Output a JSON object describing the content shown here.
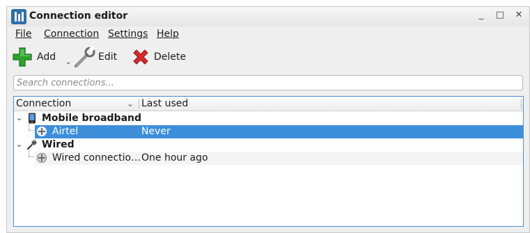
{
  "window": {
    "title": "Connection editor"
  },
  "window_controls": {
    "minimize": "_",
    "maximize": "□",
    "close": "✕"
  },
  "menu": {
    "items": [
      "File",
      "Connection",
      "Settings",
      "Help"
    ]
  },
  "toolbar": {
    "add_label": "Add",
    "add_dropdown": "⌄",
    "edit_label": "Edit",
    "delete_label": "Delete"
  },
  "search": {
    "placeholder": "Search connections...",
    "value": ""
  },
  "table": {
    "headers": [
      "Connection",
      "Last used"
    ],
    "sort_indicator": "⌄",
    "groups": [
      {
        "name": "Mobile broadband",
        "icon": "phone-icon",
        "expander": "⌄",
        "rows": [
          {
            "name": "Airtel",
            "last_used": "Never",
            "selected": true
          }
        ]
      },
      {
        "name": "Wired",
        "icon": "ethernet-plug-icon",
        "expander": "⌄",
        "rows": [
          {
            "name": "Wired connectio…",
            "last_used": "One hour ago",
            "selected": false
          }
        ]
      }
    ]
  },
  "colors": {
    "selection": "#3d8fd9",
    "add_icon": "#2ea12e",
    "delete_icon": "#d92b2b",
    "accent_border": "#4a90d9"
  }
}
